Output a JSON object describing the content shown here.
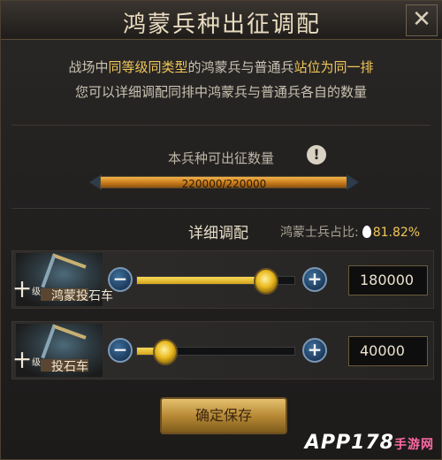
{
  "dialog": {
    "title": "鸿蒙兵种出征调配",
    "close_glyph": "✕"
  },
  "description": {
    "line1": [
      {
        "text": "战场中",
        "hl": false
      },
      {
        "text": "同等级同类型",
        "hl": true
      },
      {
        "text": "的鸿蒙兵与普通兵",
        "hl": false
      },
      {
        "text": "站位为同一排",
        "hl": true
      }
    ],
    "line2": "您可以详细调配同排中鸿蒙兵与普通兵各自的数量"
  },
  "available": {
    "label": "本兵种可出征数量",
    "info_glyph": "!",
    "text": "220000/220000",
    "fraction": 1.0
  },
  "detail": {
    "title": "详细调配",
    "ratio_label": "鸿蒙士兵占比:",
    "ratio_value": "81.82%"
  },
  "units": [
    {
      "tier": "十",
      "tier_sub": "级",
      "name": "鸿蒙投石车",
      "quantity": "180000",
      "fraction": 0.82
    },
    {
      "tier": "十",
      "tier_sub": "级",
      "name": "投石车",
      "quantity": "40000",
      "fraction": 0.18
    }
  ],
  "controls": {
    "minus": "−",
    "plus": "+"
  },
  "confirm_label": "确定保存",
  "watermark": {
    "main": "APP178",
    "sub": "手游网",
    "url": "com"
  },
  "colors": {
    "highlight": "#f0c75a",
    "slider_fill": "#f8da5a",
    "bar_fill": "#e29a2f",
    "button_blue": "#2a5d8a"
  }
}
